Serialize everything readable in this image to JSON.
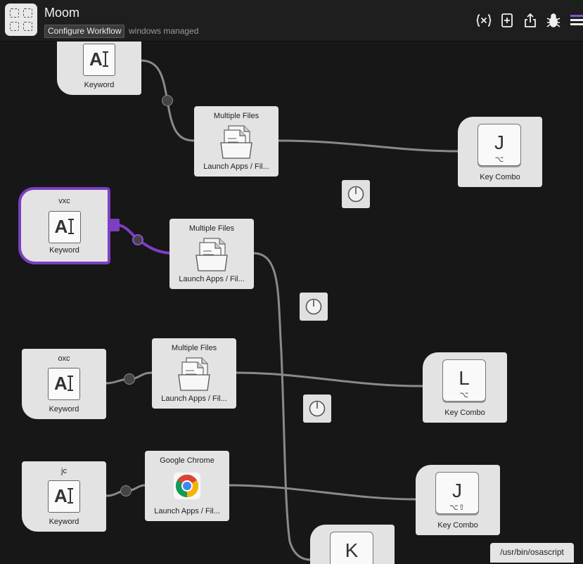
{
  "app": {
    "title": "Moom",
    "configure_label": "Configure Workflow",
    "subtitle": "windows managed"
  },
  "toolbar": {
    "icons": [
      "variables-icon",
      "add-object-icon",
      "share-icon",
      "debug-icon",
      "sidebar-menu-icon"
    ]
  },
  "accent_color": "#7b3fc2",
  "nodes": {
    "keyword_top": {
      "label": "Keyword"
    },
    "keyword_vxc": {
      "title": "vxc",
      "label": "Keyword"
    },
    "keyword_oxc": {
      "title": "oxc",
      "label": "Keyword"
    },
    "keyword_jc": {
      "title": "jc",
      "label": "Keyword"
    },
    "launch_1": {
      "title": "Multiple Files",
      "label": "Launch Apps / Fil..."
    },
    "launch_2": {
      "title": "Multiple Files",
      "label": "Launch Apps / Fil..."
    },
    "launch_3": {
      "title": "Multiple Files",
      "label": "Launch Apps / Fil..."
    },
    "launch_4": {
      "title": "Google Chrome",
      "label": "Launch Apps / Fil..."
    },
    "keycombo_1": {
      "key": "J",
      "modifiers": "⌥",
      "label": "Key Combo"
    },
    "keycombo_2": {
      "key": "L",
      "modifiers": "⌥",
      "label": "Key Combo"
    },
    "keycombo_3": {
      "key": "J",
      "modifiers": "⌥⇧",
      "label": "Key Combo"
    },
    "keycombo_4": {
      "key": "K"
    }
  },
  "script_badge": "/usr/bin/osascript"
}
